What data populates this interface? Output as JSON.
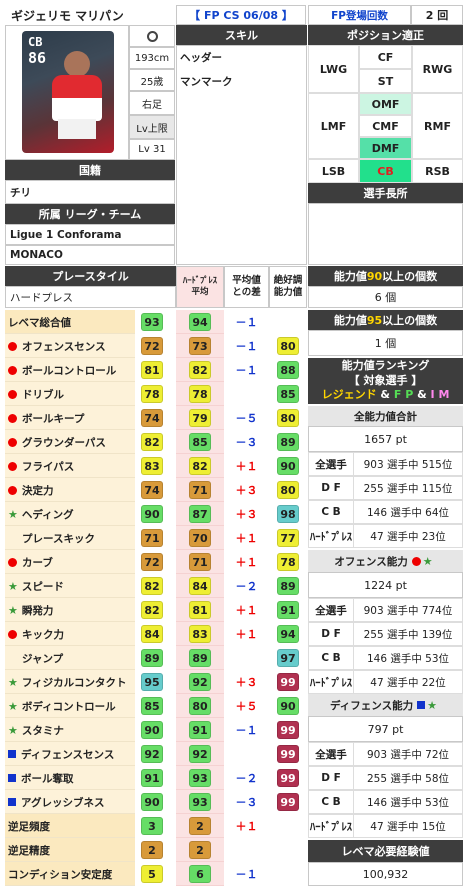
{
  "header": {
    "name": "ギジェリモ マリパン",
    "card_type": "【 FP CS 06/08 】",
    "fp_count_label": "FP登場回数",
    "fp_count_value": "2 回"
  },
  "card": {
    "position": "CB",
    "rating": "86",
    "height": "193cm",
    "age": "25歳",
    "foot": "右足",
    "lv_label": "Lv上限",
    "lv": "Lv 31"
  },
  "skill": {
    "header": "スキル",
    "items": [
      "ヘッダー",
      "マンマーク"
    ]
  },
  "position_fit": {
    "header": "ポジション適正",
    "cells": {
      "LWG": "LWG",
      "CF": "CF",
      "RWG": "RWG",
      "ST": "ST",
      "LMF": "LMF",
      "OMF": "OMF",
      "CMF": "CMF",
      "RMF": "RMF",
      "DMF": "DMF",
      "LSB": "LSB",
      "CB": "CB",
      "RSB": "RSB"
    },
    "strength_header": "選手長所"
  },
  "nationality": {
    "header": "国籍",
    "value": "チリ"
  },
  "club": {
    "header": "所属 リーグ・チーム",
    "league": "Ligue 1 Conforama",
    "team": "MONACO"
  },
  "playstyle": {
    "header": "プレースタイル",
    "value": "ハードプレス"
  },
  "cols": {
    "hp1": "ﾊｰﾄﾞﾌﾟﾚｽ",
    "hp2": "平均",
    "diff1": "平均値",
    "diff2": "との差",
    "top1": "絶好調",
    "top2": "能力値"
  },
  "stats": [
    {
      "label": "レベマ総合値",
      "mark": "none",
      "v": "93",
      "c": "#66dd66",
      "avg": "94",
      "ac": "#66dd66",
      "diff": "－１",
      "dc": "b",
      "top": ""
    },
    {
      "label": "オフェンスセンス",
      "mark": "ball",
      "v": "72",
      "c": "#d89a3a",
      "avg": "73",
      "ac": "#d89a3a",
      "diff": "－１",
      "dc": "b",
      "top": "80",
      "tc": "#eeee33"
    },
    {
      "label": "ボールコントロール",
      "mark": "ball",
      "v": "81",
      "c": "#eeee33",
      "avg": "82",
      "ac": "#eeee33",
      "diff": "－１",
      "dc": "b",
      "top": "88",
      "tc": "#66dd66"
    },
    {
      "label": "ドリブル",
      "mark": "ball",
      "v": "78",
      "c": "#eeee33",
      "avg": "78",
      "ac": "#eeee33",
      "diff": "",
      "dc": "b",
      "top": "85",
      "tc": "#66dd66"
    },
    {
      "label": "ボールキープ",
      "mark": "ball",
      "v": "74",
      "c": "#d89a3a",
      "avg": "79",
      "ac": "#eeee33",
      "diff": "－５",
      "dc": "b",
      "top": "80",
      "tc": "#eeee33"
    },
    {
      "label": "グラウンダーパス",
      "mark": "ball",
      "v": "82",
      "c": "#eeee33",
      "avg": "85",
      "ac": "#66dd66",
      "diff": "－３",
      "dc": "b",
      "top": "89",
      "tc": "#66dd66"
    },
    {
      "label": "フライパス",
      "mark": "ball",
      "v": "83",
      "c": "#eeee33",
      "avg": "82",
      "ac": "#eeee33",
      "diff": "＋１",
      "dc": "r",
      "top": "90",
      "tc": "#66dd66"
    },
    {
      "label": "決定力",
      "mark": "ball",
      "v": "74",
      "c": "#d89a3a",
      "avg": "71",
      "ac": "#d89a3a",
      "diff": "＋３",
      "dc": "r",
      "top": "80",
      "tc": "#eeee33"
    },
    {
      "label": "ヘディング",
      "mark": "star",
      "v": "90",
      "c": "#66dd66",
      "avg": "87",
      "ac": "#66dd66",
      "diff": "＋３",
      "dc": "r",
      "top": "98",
      "tc": "#66cccc"
    },
    {
      "label": "プレースキック",
      "mark": "none2",
      "v": "71",
      "c": "#d89a3a",
      "avg": "70",
      "ac": "#d89a3a",
      "diff": "＋１",
      "dc": "r",
      "top": "77",
      "tc": "#eeee33"
    },
    {
      "label": "カーブ",
      "mark": "ball",
      "v": "72",
      "c": "#d89a3a",
      "avg": "71",
      "ac": "#d89a3a",
      "diff": "＋１",
      "dc": "r",
      "top": "78",
      "tc": "#eeee33"
    },
    {
      "label": "スピード",
      "mark": "star",
      "v": "82",
      "c": "#eeee33",
      "avg": "84",
      "ac": "#eeee33",
      "diff": "－２",
      "dc": "b",
      "top": "89",
      "tc": "#66dd66"
    },
    {
      "label": "瞬発力",
      "mark": "star",
      "v": "82",
      "c": "#eeee33",
      "avg": "81",
      "ac": "#eeee33",
      "diff": "＋１",
      "dc": "r",
      "top": "91",
      "tc": "#66dd66"
    },
    {
      "label": "キック力",
      "mark": "ball",
      "v": "84",
      "c": "#eeee33",
      "avg": "83",
      "ac": "#eeee33",
      "diff": "＋１",
      "dc": "r",
      "top": "94",
      "tc": "#66dd66"
    },
    {
      "label": "ジャンプ",
      "mark": "none2",
      "v": "89",
      "c": "#66dd66",
      "avg": "89",
      "ac": "#66dd66",
      "diff": "",
      "dc": "b",
      "top": "97",
      "tc": "#66cccc"
    },
    {
      "label": "フィジカルコンタクト",
      "mark": "star",
      "v": "95",
      "c": "#66cccc",
      "avg": "92",
      "ac": "#66dd66",
      "diff": "＋３",
      "dc": "r",
      "top": "99",
      "tc": "#b03050"
    },
    {
      "label": "ボディコントロール",
      "mark": "star",
      "v": "85",
      "c": "#66dd66",
      "avg": "80",
      "ac": "#66dd66",
      "diff": "＋５",
      "dc": "r",
      "top": "90",
      "tc": "#66dd66"
    },
    {
      "label": "スタミナ",
      "mark": "star",
      "v": "90",
      "c": "#66dd66",
      "avg": "91",
      "ac": "#66dd66",
      "diff": "－１",
      "dc": "b",
      "top": "99",
      "tc": "#b03050"
    },
    {
      "label": "ディフェンスセンス",
      "mark": "sq",
      "v": "92",
      "c": "#66dd66",
      "avg": "92",
      "ac": "#66dd66",
      "diff": "",
      "dc": "b",
      "top": "99",
      "tc": "#b03050"
    },
    {
      "label": "ボール奪取",
      "mark": "sq",
      "v": "91",
      "c": "#66dd66",
      "avg": "93",
      "ac": "#66dd66",
      "diff": "－２",
      "dc": "b",
      "top": "99",
      "tc": "#b03050"
    },
    {
      "label": "アグレッシブネス",
      "mark": "sq",
      "v": "90",
      "c": "#66dd66",
      "avg": "93",
      "ac": "#66dd66",
      "diff": "－３",
      "dc": "b",
      "top": "99",
      "tc": "#b03050"
    },
    {
      "label": "逆足頻度",
      "mark": "none",
      "v": "3",
      "c": "#66dd66",
      "avg": "2",
      "ac": "#d89a3a",
      "diff": "＋１",
      "dc": "r",
      "top": ""
    },
    {
      "label": "逆足精度",
      "mark": "none",
      "v": "2",
      "c": "#d89a3a",
      "avg": "2",
      "ac": "#d89a3a",
      "diff": "",
      "dc": "b",
      "top": ""
    },
    {
      "label": "コンディション安定度",
      "mark": "none",
      "v": "5",
      "c": "#eeee33",
      "avg": "6",
      "ac": "#66dd66",
      "diff": "－１",
      "dc": "b",
      "top": ""
    }
  ],
  "right": {
    "count90_pre": "能力値 ",
    "count90_num": "90",
    "count90_post": " 以上の個数",
    "count90_val": "6 個",
    "count95_pre": "能力値 ",
    "count95_num": "95",
    "count95_post": " 以上の個数",
    "count95_val": "1 個",
    "rank_title": "能力値ランキング",
    "rank_sub": "【 対象選手 】",
    "rank_leg": "レジェンド",
    "rank_amp1": " & ",
    "rank_fp": "F P",
    "rank_amp2": " & ",
    "rank_im": "I M",
    "total_header": "全能力値合計",
    "total_pt": "1657 pt",
    "total_rows": [
      {
        "k": "全選手",
        "v": "903 選手中 515位"
      },
      {
        "k": "D F",
        "v": "255 選手中 115位"
      },
      {
        "k": "C B",
        "v": "146 選手中 64位"
      },
      {
        "k": "ﾊｰﾄﾞﾌﾟﾚｽ",
        "v": "47 選手中 23位"
      }
    ],
    "off_header": "オフェンス能力",
    "off_pt": "1224 pt",
    "off_rows": [
      {
        "k": "全選手",
        "v": "903 選手中 774位"
      },
      {
        "k": "D F",
        "v": "255 選手中 139位"
      },
      {
        "k": "C B",
        "v": "146 選手中 53位"
      },
      {
        "k": "ﾊｰﾄﾞﾌﾟﾚｽ",
        "v": "47 選手中 22位"
      }
    ],
    "def_header": "ディフェンス能力",
    "def_pt": "797 pt",
    "def_rows": [
      {
        "k": "全選手",
        "v": "903 選手中 72位"
      },
      {
        "k": "D F",
        "v": "255 選手中 58位"
      },
      {
        "k": "C B",
        "v": "146 選手中 53位"
      },
      {
        "k": "ﾊｰﾄﾞﾌﾟﾚｽ",
        "v": "47 選手中 15位"
      }
    ],
    "exp_header": "レベマ必要経験値",
    "exp_val": "100,932"
  }
}
